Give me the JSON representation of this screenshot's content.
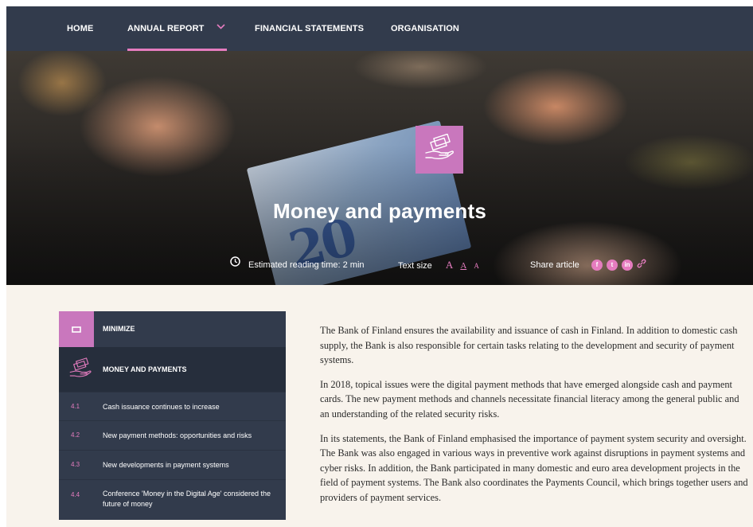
{
  "nav": {
    "items": [
      {
        "label": "HOME"
      },
      {
        "label": "ANNUAL REPORT"
      },
      {
        "label": "FINANCIAL STATEMENTS"
      },
      {
        "label": "ORGANISATION"
      }
    ],
    "active_index": 1
  },
  "hero": {
    "title": "Money and payments",
    "badge_icon": "hand-with-money-icon",
    "reading_time": "Estimated reading time: 2 min",
    "text_size_label": "Text size",
    "text_size_options": [
      "A",
      "A",
      "A"
    ],
    "share_label": "Share article",
    "share_icons": [
      {
        "name": "facebook-icon",
        "glyph": "f"
      },
      {
        "name": "twitter-icon",
        "glyph": "t"
      },
      {
        "name": "linkedin-icon",
        "glyph": "in"
      },
      {
        "name": "link-icon",
        "glyph": ""
      }
    ]
  },
  "sidebar": {
    "minimize_label": "MINIMIZE",
    "section_title": "MONEY AND PAYMENTS",
    "items": [
      {
        "number": "4.1",
        "label": "Cash issuance continues to increase"
      },
      {
        "number": "4.2",
        "label": "New payment methods: opportunities and risks"
      },
      {
        "number": "4.3",
        "label": "New developments in payment systems"
      },
      {
        "number": "4.4",
        "label": "Conference 'Money in the Digital Age' considered the future of money"
      }
    ]
  },
  "article": {
    "paragraphs": [
      "The Bank of Finland ensures the availability and issuance of cash in Finland. In addition to domestic cash supply, the Bank is also responsible for certain tasks relating to the development and security of payment systems.",
      "In 2018, topical issues were the digital payment methods that have emerged alongside cash and payment cards. The new payment methods and channels necessitate financial literacy among the general public and an understanding of the related security risks.",
      "In its statements, the Bank of Finland emphasised the importance of payment system security and oversight. The Bank was also engaged in various ways in preventive work against disruptions in payment systems and cyber risks. In addition, the Bank participated in many domestic and euro area development projects in the field of payment systems. The Bank also coordinates the Payments Council, which brings together users and providers of payment services."
    ]
  },
  "colors": {
    "nav_bg": "#323b4c",
    "accent_pink": "#e57cbf",
    "badge_purple": "#c977bd",
    "page_bg": "#f8f3ec"
  }
}
